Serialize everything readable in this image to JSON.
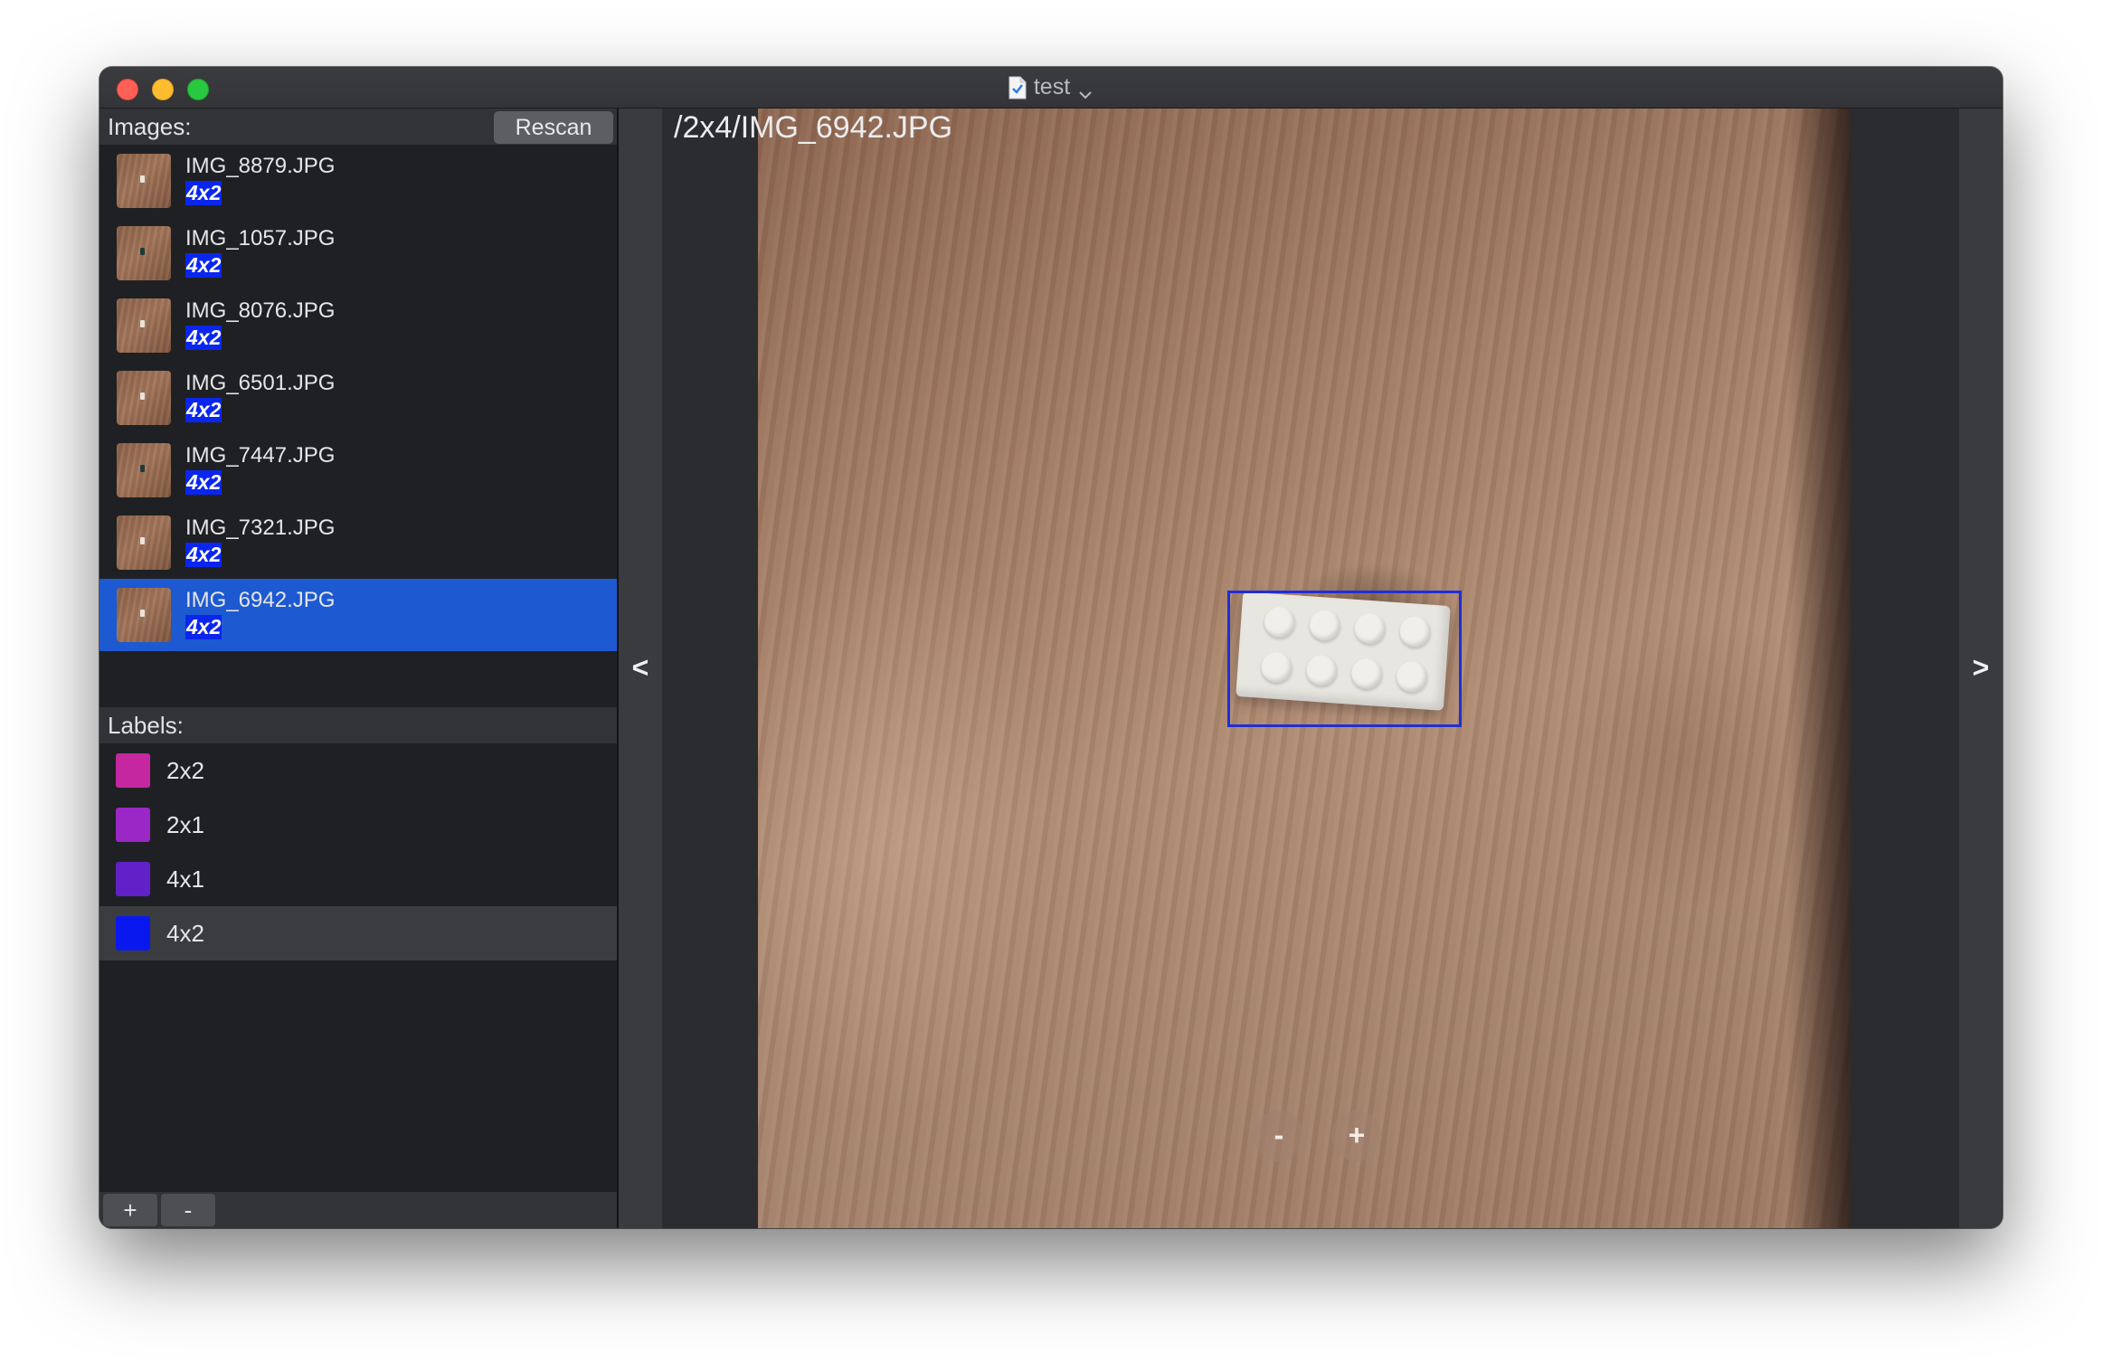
{
  "window": {
    "title": "test"
  },
  "sidebar": {
    "images_header": "Images:",
    "rescan_label": "Rescan",
    "images": [
      {
        "name": "IMG_8879.JPG",
        "label": "4x2",
        "brick": "light"
      },
      {
        "name": "IMG_1057.JPG",
        "label": "4x2",
        "brick": "dark"
      },
      {
        "name": "IMG_8076.JPG",
        "label": "4x2",
        "brick": "light"
      },
      {
        "name": "IMG_6501.JPG",
        "label": "4x2",
        "brick": "light"
      },
      {
        "name": "IMG_7447.JPG",
        "label": "4x2",
        "brick": "dark"
      },
      {
        "name": "IMG_7321.JPG",
        "label": "4x2",
        "brick": "light"
      },
      {
        "name": "IMG_6942.JPG",
        "label": "4x2",
        "brick": "light",
        "selected": true
      }
    ],
    "labels_header": "Labels:",
    "labels": [
      {
        "name": "2x2",
        "color": "#c4279f"
      },
      {
        "name": "2x1",
        "color": "#9a27c6"
      },
      {
        "name": "4x1",
        "color": "#6120c8"
      },
      {
        "name": "4x2",
        "color": "#0a18f0",
        "selected": true
      }
    ],
    "add_label": "+",
    "remove_label": "-"
  },
  "main": {
    "path": "/2x4/IMG_6942.JPG",
    "prev_label": "<",
    "next_label": ">",
    "zoom_out_label": "-",
    "zoom_in_label": "+",
    "annotation_label": "4x2"
  },
  "colors": {
    "selection": "#1d59d1",
    "label_badge": "#0a26ee",
    "bbox": "#1f2fd6"
  }
}
